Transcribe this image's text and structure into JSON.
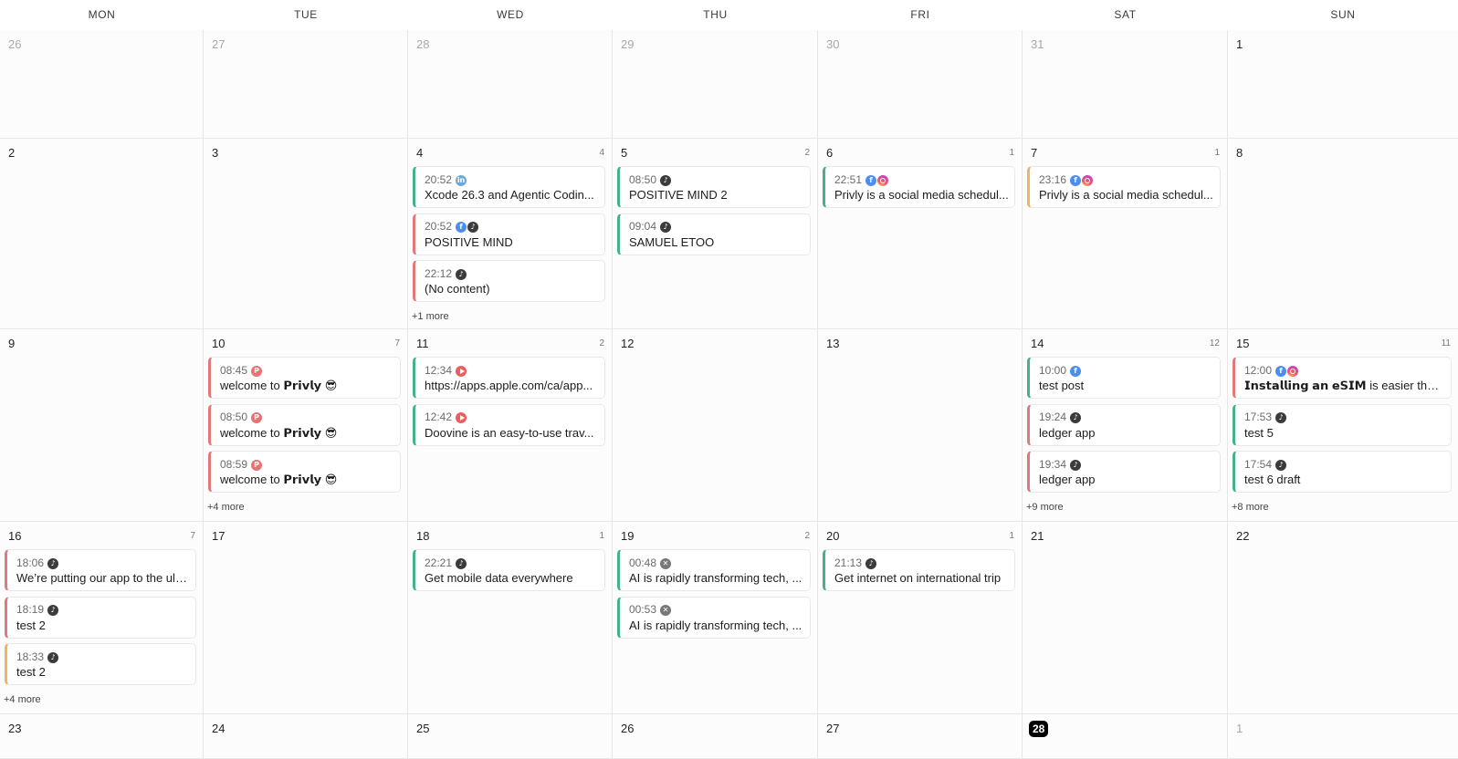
{
  "weekdays": [
    "MON",
    "TUE",
    "WED",
    "THU",
    "FRI",
    "SAT",
    "SUN"
  ],
  "weeks": [
    {
      "days": [
        {
          "date": "26",
          "muted": true,
          "count": "",
          "events": [],
          "more": ""
        },
        {
          "date": "27",
          "muted": true,
          "count": "",
          "events": [],
          "more": ""
        },
        {
          "date": "28",
          "muted": true,
          "count": "",
          "events": [],
          "more": ""
        },
        {
          "date": "29",
          "muted": true,
          "count": "",
          "events": [],
          "more": ""
        },
        {
          "date": "30",
          "muted": true,
          "count": "",
          "events": [],
          "more": ""
        },
        {
          "date": "31",
          "muted": true,
          "count": "",
          "events": [],
          "more": ""
        },
        {
          "date": "1",
          "count": "",
          "events": [],
          "more": ""
        }
      ]
    },
    {
      "days": [
        {
          "date": "2",
          "count": "",
          "events": [],
          "more": ""
        },
        {
          "date": "3",
          "count": "",
          "events": [],
          "more": ""
        },
        {
          "date": "4",
          "count": "4",
          "events": [
            {
              "time": "20:52",
              "platforms": [
                "linkedin"
              ],
              "title": "Xcode 26.3 and Agentic Codin...",
              "color": "green"
            },
            {
              "time": "20:52",
              "platforms": [
                "facebook",
                "tiktok"
              ],
              "title": "POSITIVE MIND",
              "color": "red"
            },
            {
              "time": "22:12",
              "platforms": [
                "tiktok"
              ],
              "title": "(No content)",
              "color": "red"
            }
          ],
          "more": "+1 more"
        },
        {
          "date": "5",
          "count": "2",
          "events": [
            {
              "time": "08:50",
              "platforms": [
                "tiktok"
              ],
              "title": "POSITIVE MIND 2",
              "color": "green"
            },
            {
              "time": "09:04",
              "platforms": [
                "tiktok"
              ],
              "title": "SAMUEL ETOO",
              "color": "green"
            }
          ],
          "more": ""
        },
        {
          "date": "6",
          "count": "1",
          "events": [
            {
              "time": "22:51",
              "platforms": [
                "facebook",
                "instagram"
              ],
              "title": "Privly is a social media schedul...",
              "color": "green"
            }
          ],
          "more": ""
        },
        {
          "date": "7",
          "count": "1",
          "events": [
            {
              "time": "23:16",
              "platforms": [
                "facebook",
                "instagram"
              ],
              "title": "Privly is a social media schedul...",
              "color": "orange"
            }
          ],
          "more": ""
        },
        {
          "date": "8",
          "count": "",
          "events": [],
          "more": ""
        }
      ]
    },
    {
      "days": [
        {
          "date": "9",
          "count": "",
          "events": [],
          "more": ""
        },
        {
          "date": "10",
          "count": "7",
          "events": [
            {
              "time": "08:45",
              "platforms": [
                "pinterest"
              ],
              "title": "welcome to 𝗣𝗿𝗶𝘃𝗹𝘆 😎",
              "color": "red"
            },
            {
              "time": "08:50",
              "platforms": [
                "pinterest"
              ],
              "title": "welcome to 𝗣𝗿𝗶𝘃𝗹𝘆 😎",
              "color": "red"
            },
            {
              "time": "08:59",
              "platforms": [
                "pinterest"
              ],
              "title": "welcome to 𝗣𝗿𝗶𝘃𝗹𝘆 😎",
              "color": "red"
            }
          ],
          "more": "+4 more"
        },
        {
          "date": "11",
          "count": "2",
          "events": [
            {
              "time": "12:34",
              "platforms": [
                "youtube"
              ],
              "title": "https://apps.apple.com/ca/app...",
              "color": "green"
            },
            {
              "time": "12:42",
              "platforms": [
                "youtube"
              ],
              "title": "Doovine is an easy-to-use trav...",
              "color": "green"
            }
          ],
          "more": ""
        },
        {
          "date": "12",
          "count": "",
          "events": [],
          "more": ""
        },
        {
          "date": "13",
          "count": "",
          "events": [],
          "more": ""
        },
        {
          "date": "14",
          "count": "12",
          "events": [
            {
              "time": "10:00",
              "platforms": [
                "facebook"
              ],
              "title": "test post",
              "color": "green"
            },
            {
              "time": "19:24",
              "platforms": [
                "tiktok"
              ],
              "title": "ledger app",
              "color": "red"
            },
            {
              "time": "19:34",
              "platforms": [
                "tiktok"
              ],
              "title": "ledger app",
              "color": "red"
            }
          ],
          "more": "+9 more"
        },
        {
          "date": "15",
          "count": "11",
          "events": [
            {
              "time": "12:00",
              "platforms": [
                "facebook",
                "instagram"
              ],
              "title": "𝗜𝗻𝘀𝘁𝗮𝗹𝗹𝗶𝗻𝗴 𝗮𝗻 𝗲𝗦𝗜𝗠 is easier than ...",
              "color": "red"
            },
            {
              "time": "17:53",
              "platforms": [
                "tiktok"
              ],
              "title": "test 5",
              "color": "green"
            },
            {
              "time": "17:54",
              "platforms": [
                "tiktok"
              ],
              "title": "test 6 draft",
              "color": "green"
            }
          ],
          "more": "+8 more"
        }
      ]
    },
    {
      "days": [
        {
          "date": "16",
          "count": "7",
          "events": [
            {
              "time": "18:06",
              "platforms": [
                "tiktok"
              ],
              "title": "We’re putting our app to the ulti...",
              "color": "red"
            },
            {
              "time": "18:19",
              "platforms": [
                "tiktok"
              ],
              "title": "test 2",
              "color": "red"
            },
            {
              "time": "18:33",
              "platforms": [
                "tiktok"
              ],
              "title": "test 2",
              "color": "orange"
            }
          ],
          "more": "+4 more"
        },
        {
          "date": "17",
          "count": "",
          "events": [],
          "more": ""
        },
        {
          "date": "18",
          "count": "1",
          "events": [
            {
              "time": "22:21",
              "platforms": [
                "tiktok"
              ],
              "title": "Get mobile data everywhere",
              "color": "green"
            }
          ],
          "more": ""
        },
        {
          "date": "19",
          "count": "2",
          "events": [
            {
              "time": "00:48",
              "platforms": [
                "x"
              ],
              "title": "AI is rapidly transforming tech, ...",
              "color": "green"
            },
            {
              "time": "00:53",
              "platforms": [
                "x"
              ],
              "title": "AI is rapidly transforming tech, ...",
              "color": "green"
            }
          ],
          "more": ""
        },
        {
          "date": "20",
          "count": "1",
          "events": [
            {
              "time": "21:13",
              "platforms": [
                "tiktok"
              ],
              "title": "Get internet on international trip",
              "color": "green"
            }
          ],
          "more": ""
        },
        {
          "date": "21",
          "count": "",
          "events": [],
          "more": ""
        },
        {
          "date": "22",
          "count": "",
          "events": [],
          "more": ""
        }
      ]
    },
    {
      "days": [
        {
          "date": "23",
          "count": "",
          "events": [],
          "more": ""
        },
        {
          "date": "24",
          "count": "",
          "events": [],
          "more": ""
        },
        {
          "date": "25",
          "count": "",
          "events": [],
          "more": ""
        },
        {
          "date": "26",
          "count": "",
          "events": [],
          "more": ""
        },
        {
          "date": "27",
          "count": "",
          "events": [],
          "more": ""
        },
        {
          "date": "28",
          "today": true,
          "count": "",
          "events": [],
          "more": ""
        },
        {
          "date": "1",
          "muted": true,
          "count": "",
          "events": [],
          "more": ""
        }
      ]
    }
  ],
  "platform_icons": {
    "linkedin": "linkedin-icon",
    "facebook": "facebook-icon",
    "instagram": "instagram-icon",
    "tiktok": "tiktok-icon",
    "pinterest": "pinterest-icon",
    "youtube": "youtube-icon",
    "x": "x-icon"
  },
  "colors": {
    "green": "#45b08c",
    "red": "#e07a7a",
    "orange": "#efb266",
    "today_bg": "#000000"
  }
}
